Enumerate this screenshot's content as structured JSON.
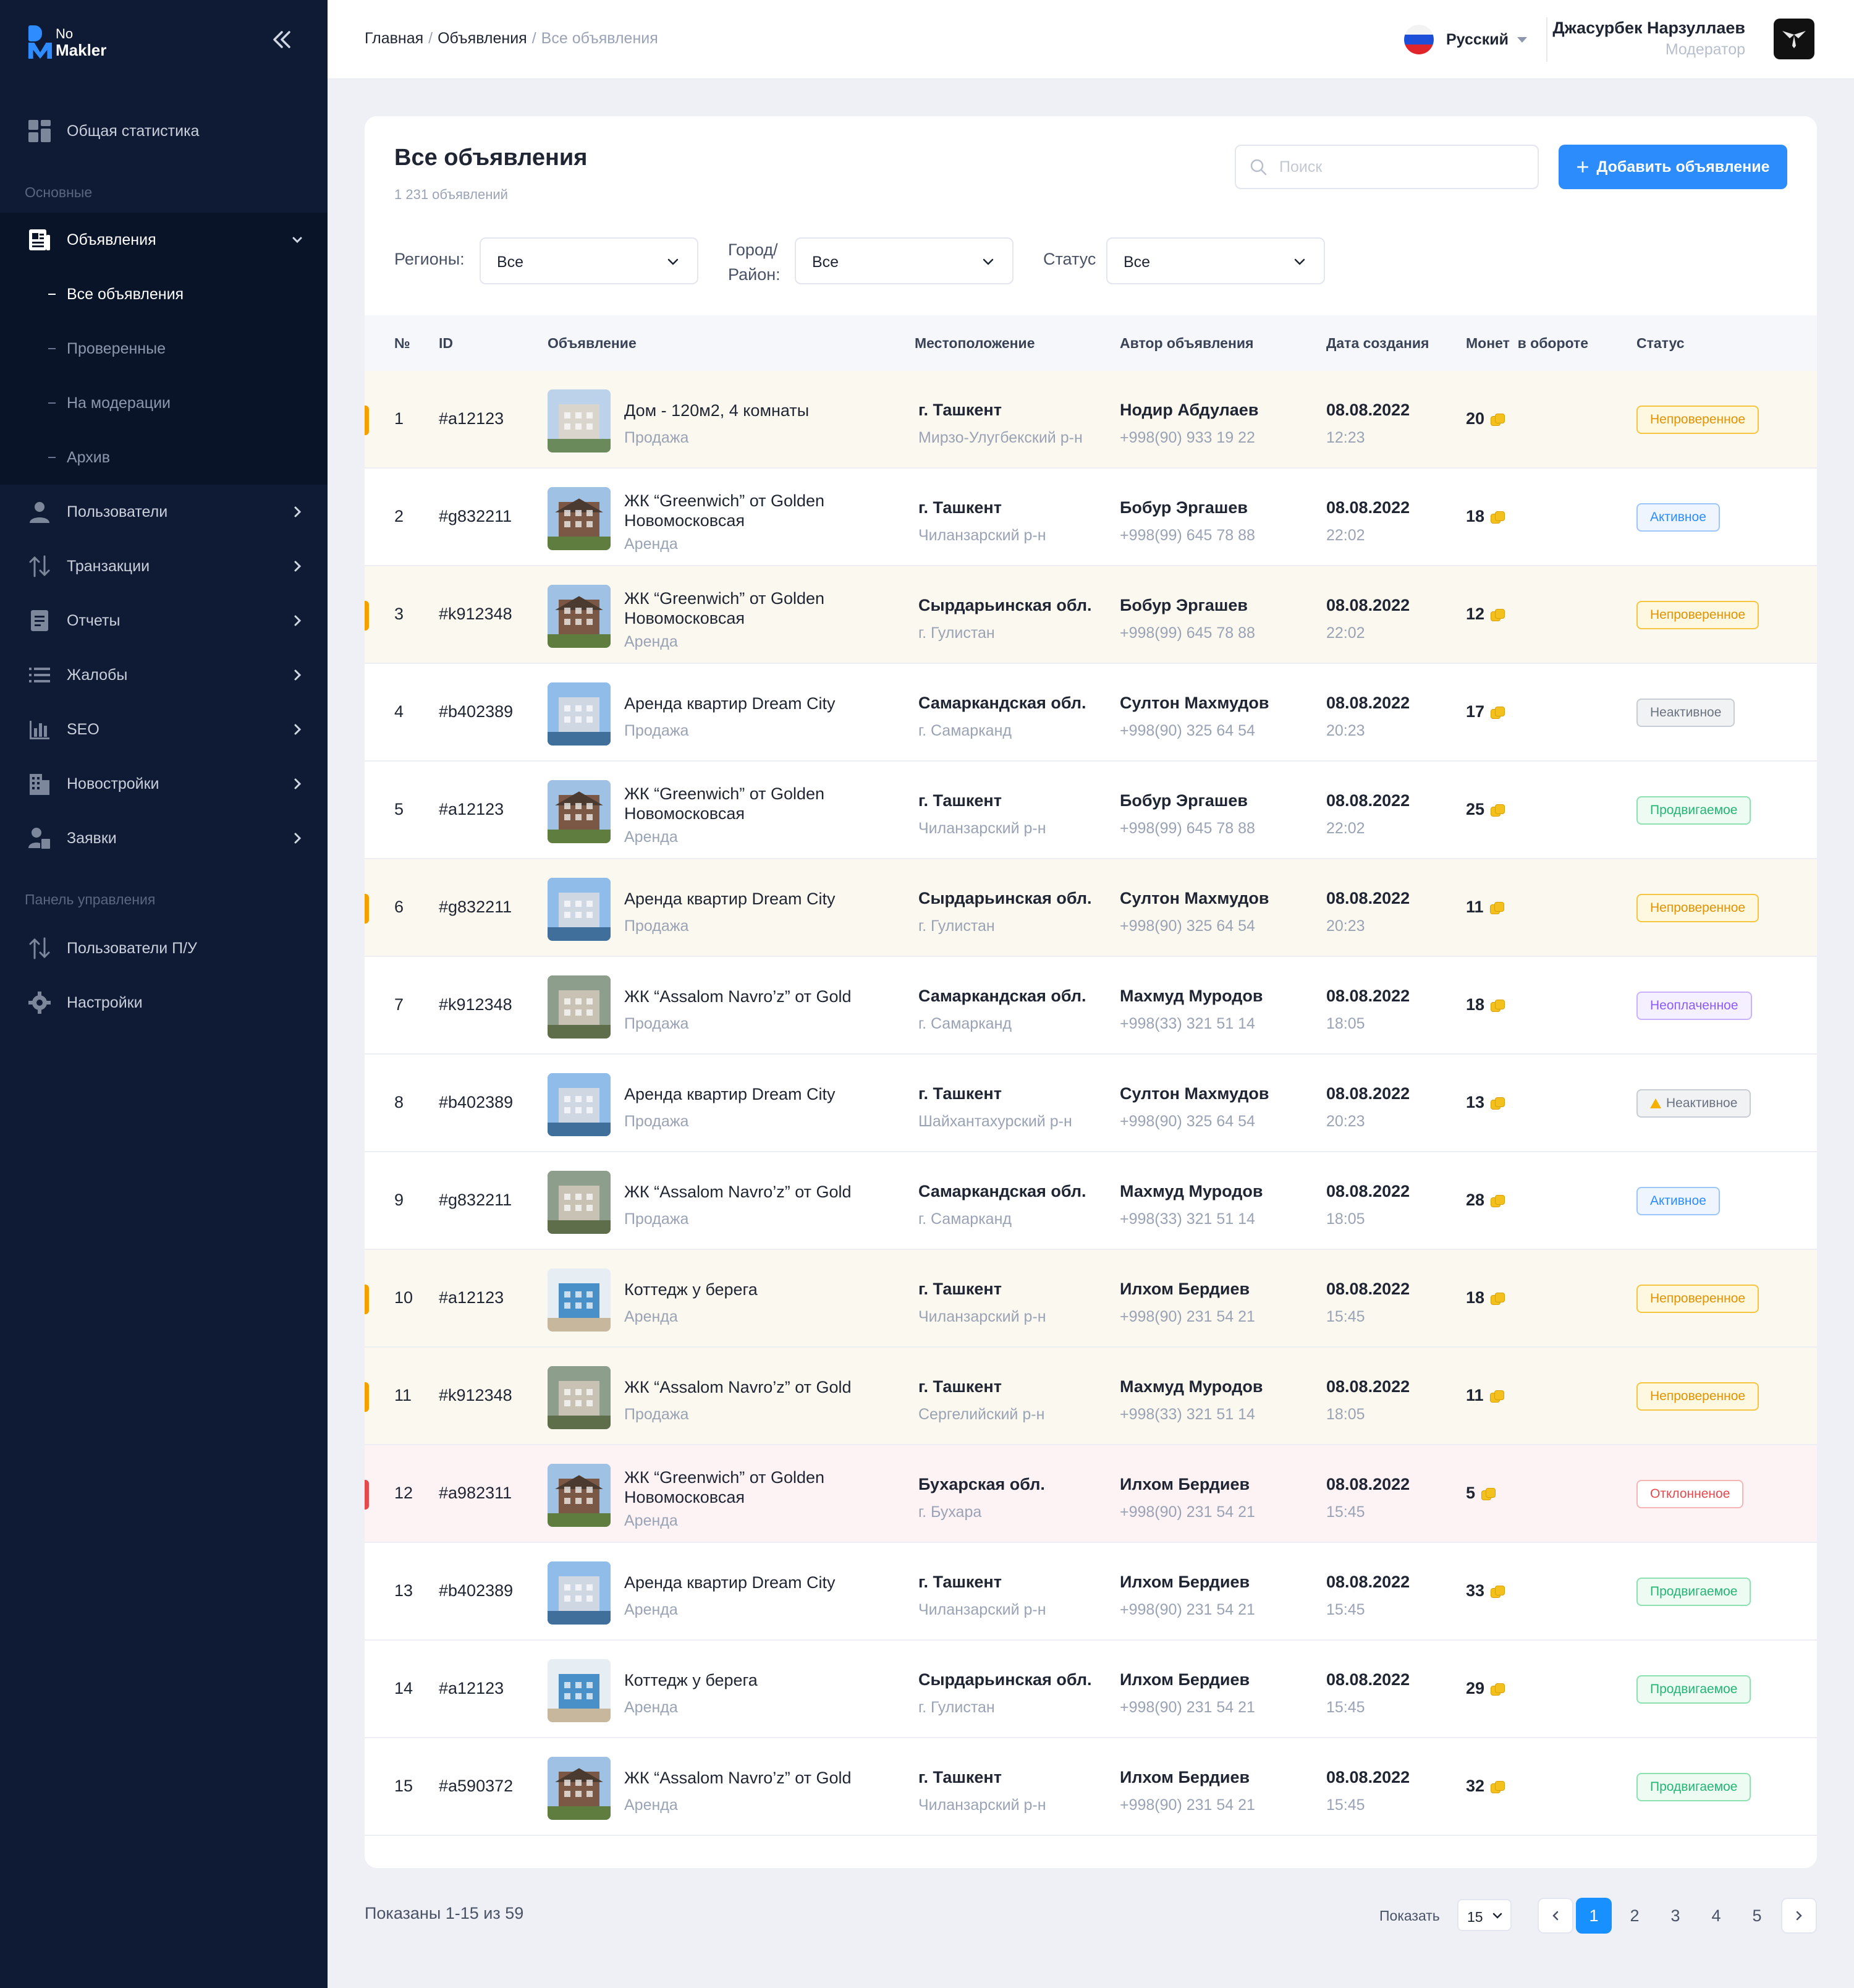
{
  "app": {
    "logo_line1": "No",
    "logo_line2": "Makler"
  },
  "sidebar": {
    "stats_label": "Общая статистика",
    "section_main": "Основные",
    "listings_label": "Объявления",
    "sub_items": [
      {
        "label": "Все объявления",
        "active": true
      },
      {
        "label": "Проверенные",
        "active": false
      },
      {
        "label": "На модерации",
        "active": false
      },
      {
        "label": "Архив",
        "active": false
      }
    ],
    "items": [
      {
        "label": "Пользователи",
        "icon": "user-icon"
      },
      {
        "label": "Транзакции",
        "icon": "transactions-icon"
      },
      {
        "label": "Отчеты",
        "icon": "report-icon"
      },
      {
        "label": "Жалобы",
        "icon": "list-icon"
      },
      {
        "label": "SEO",
        "icon": "bar-chart-icon"
      },
      {
        "label": "Новостройки",
        "icon": "building-icon"
      },
      {
        "label": "Заявки",
        "icon": "request-icon"
      }
    ],
    "section_panel": "Панель управления",
    "panel_items": [
      {
        "label": "Пользователи П/У",
        "icon": "transactions-icon"
      },
      {
        "label": "Настройки",
        "icon": "gear-icon"
      }
    ]
  },
  "header": {
    "breadcrumb": [
      "Главная",
      "Объявления",
      "Все объявления"
    ],
    "language": "Русский",
    "user_name": "Джасурбек Нарзуллаев",
    "user_role": "Модератор"
  },
  "main": {
    "title": "Все объявления",
    "count_text": "1 231 объявлений",
    "search_placeholder": "Поиск",
    "add_button": "Добавить объявление",
    "filters": {
      "region_label": "Регионы:",
      "region_value": "Все",
      "city_label_1": "Город/",
      "city_label_2": "Район:",
      "city_value": "Все",
      "status_label": "Статус",
      "status_value": "Все"
    },
    "columns": [
      "№",
      "ID",
      "Объявление",
      "Местоположение",
      "Автор объявления",
      "Дата создания",
      "Монет  в обороте",
      "Статус"
    ],
    "rows": [
      {
        "n": "1",
        "id": "#a12123",
        "title": "Дом - 120м2, 4 комнаты",
        "type": "Продажа",
        "city": "г. Ташкент",
        "district": "Мирзо-Улугбекский р-н",
        "author": "Нодир Абдулаев",
        "phone": "+998(90) 933 19 22",
        "date": "08.08.2022",
        "time": "12:23",
        "coins": "20",
        "status": "Непроверенное",
        "kind": "unverified",
        "img": "tower"
      },
      {
        "n": "2",
        "id": "#g832211",
        "title": "ЖК “Greenwich” от Golden Новомосковсая",
        "type": "Аренда",
        "city": "г. Ташкент",
        "district": "Чиланзарский р-н",
        "author": "Бобур Эргашев",
        "phone": "+998(99) 645 78 88",
        "date": "08.08.2022",
        "time": "22:02",
        "coins": "18",
        "status": "Активное",
        "kind": "active",
        "img": "house"
      },
      {
        "n": "3",
        "id": "#k912348",
        "title": "ЖК “Greenwich” от Golden Новомосковсая",
        "type": "Аренда",
        "city": "Сырдарьинская обл.",
        "district": "г. Гулистан",
        "author": "Бобур Эргашев",
        "phone": "+998(99) 645 78 88",
        "date": "08.08.2022",
        "time": "22:02",
        "coins": "12",
        "status": "Непроверенное",
        "kind": "unverified",
        "img": "house"
      },
      {
        "n": "4",
        "id": "#b402389",
        "title": "Аренда квартир Dream City",
        "type": "Продажа",
        "city": "Самаркандская обл.",
        "district": "г. Самарканд",
        "author": "Султон Махмудов",
        "phone": "+998(90) 325 64 54",
        "date": "08.08.2022",
        "time": "20:23",
        "coins": "17",
        "status": "Неактивное",
        "kind": "inactive",
        "img": "city"
      },
      {
        "n": "5",
        "id": "#a12123",
        "title": "ЖК “Greenwich” от Golden Новомосковсая",
        "type": "Аренда",
        "city": "г. Ташкент",
        "district": "Чиланзарский р-н",
        "author": "Бобур Эргашев",
        "phone": "+998(99) 645 78 88",
        "date": "08.08.2022",
        "time": "22:02",
        "coins": "25",
        "status": "Продвигаемое",
        "kind": "promoted",
        "img": "house"
      },
      {
        "n": "6",
        "id": "#g832211",
        "title": "Аренда квартир Dream City",
        "type": "Продажа",
        "city": "Сырдарьинская обл.",
        "district": "г. Гулистан",
        "author": "Султон Махмудов",
        "phone": "+998(90) 325 64 54",
        "date": "08.08.2022",
        "time": "20:23",
        "coins": "11",
        "status": "Непроверенное",
        "kind": "unverified",
        "img": "city"
      },
      {
        "n": "7",
        "id": "#k912348",
        "title": "ЖК “Assalom Navro’z” от Gold",
        "type": "Продажа",
        "city": "Самаркандская обл.",
        "district": "г. Самарканд",
        "author": "Махмуд Муродов",
        "phone": "+998(33) 321 51 14",
        "date": "08.08.2022",
        "time": "18:05",
        "coins": "18",
        "status": "Неоплаченное",
        "kind": "unpaid",
        "img": "aerial"
      },
      {
        "n": "8",
        "id": "#b402389",
        "title": "Аренда квартир Dream City",
        "type": "Продажа",
        "city": "г. Ташкент",
        "district": "Шайхантахурский р-н",
        "author": "Султон Махмудов",
        "phone": "+998(90) 325 64 54",
        "date": "08.08.2022",
        "time": "20:23",
        "coins": "13",
        "status": "Неактивное",
        "kind": "inactive-warn",
        "img": "city"
      },
      {
        "n": "9",
        "id": "#g832211",
        "title": "ЖК “Assalom Navro’z” от Gold",
        "type": "Продажа",
        "city": "Самаркандская обл.",
        "district": "г. Самарканд",
        "author": "Махмуд Муродов",
        "phone": "+998(33) 321 51 14",
        "date": "08.08.2022",
        "time": "18:05",
        "coins": "28",
        "status": "Активное",
        "kind": "active",
        "img": "aerial"
      },
      {
        "n": "10",
        "id": "#a12123",
        "title": "Коттедж у берега",
        "type": "Аренда",
        "city": "г. Ташкент",
        "district": "Чиланзарский р-н",
        "author": "Илхом Бердиев",
        "phone": "+998(90) 231 54 21",
        "date": "08.08.2022",
        "time": "15:45",
        "coins": "18",
        "status": "Непроверенное",
        "kind": "unverified",
        "img": "room"
      },
      {
        "n": "11",
        "id": "#k912348",
        "title": "ЖК “Assalom Navro’z” от Gold",
        "type": "Продажа",
        "city": "г. Ташкент",
        "district": "Сергелийский р-н",
        "author": "Махмуд Муродов",
        "phone": "+998(33) 321 51 14",
        "date": "08.08.2022",
        "time": "18:05",
        "coins": "11",
        "status": "Непроверенное",
        "kind": "unverified",
        "img": "aerial"
      },
      {
        "n": "12",
        "id": "#a982311",
        "title": "ЖК “Greenwich” от Golden Новомосковсая",
        "type": "Аренда",
        "city": "Бухарская обл.",
        "district": "г. Бухара",
        "author": "Илхом Бердиев",
        "phone": "+998(90) 231 54 21",
        "date": "08.08.2022",
        "time": "15:45",
        "coins": "5",
        "status": "Отклонненое",
        "kind": "rejected",
        "img": "house"
      },
      {
        "n": "13",
        "id": "#b402389",
        "title": "Аренда квартир Dream City",
        "type": "Аренда",
        "city": "г. Ташкент",
        "district": "Чиланзарский р-н",
        "author": "Илхом Бердиев",
        "phone": "+998(90) 231 54 21",
        "date": "08.08.2022",
        "time": "15:45",
        "coins": "33",
        "status": "Продвигаемое",
        "kind": "promoted",
        "img": "city"
      },
      {
        "n": "14",
        "id": "#a12123",
        "title": "Коттедж у берега",
        "type": "Аренда",
        "city": "Сырдарьинская обл.",
        "district": "г. Гулистан",
        "author": "Илхом Бердиев",
        "phone": "+998(90) 231 54 21",
        "date": "08.08.2022",
        "time": "15:45",
        "coins": "29",
        "status": "Продвигаемое",
        "kind": "promoted",
        "img": "room"
      },
      {
        "n": "15",
        "id": "#a590372",
        "title": "ЖК “Assalom Navro’z” от Gold",
        "type": "Аренда",
        "city": "г. Ташкент",
        "district": "Чиланзарский р-н",
        "author": "Илхом Бердиев",
        "phone": "+998(90) 231 54 21",
        "date": "08.08.2022",
        "time": "15:45",
        "coins": "32",
        "status": "Продвигаемое",
        "kind": "promoted",
        "img": "house"
      }
    ]
  },
  "footer": {
    "shown_text": "Показаны 1-15 из 59",
    "show_label": "Показать",
    "per_page": "15",
    "pages": [
      "1",
      "2",
      "3",
      "4",
      "5"
    ],
    "current_page": "1"
  },
  "colors": {
    "sidebar_bg": "#0f1b34",
    "accent": "#2c8cfc",
    "unverified": "#f5a000",
    "active": "#2c8cfc",
    "inactive": "#6b7280",
    "promoted": "#22b573",
    "unpaid": "#8b5cf6",
    "rejected": "#e5484d"
  }
}
